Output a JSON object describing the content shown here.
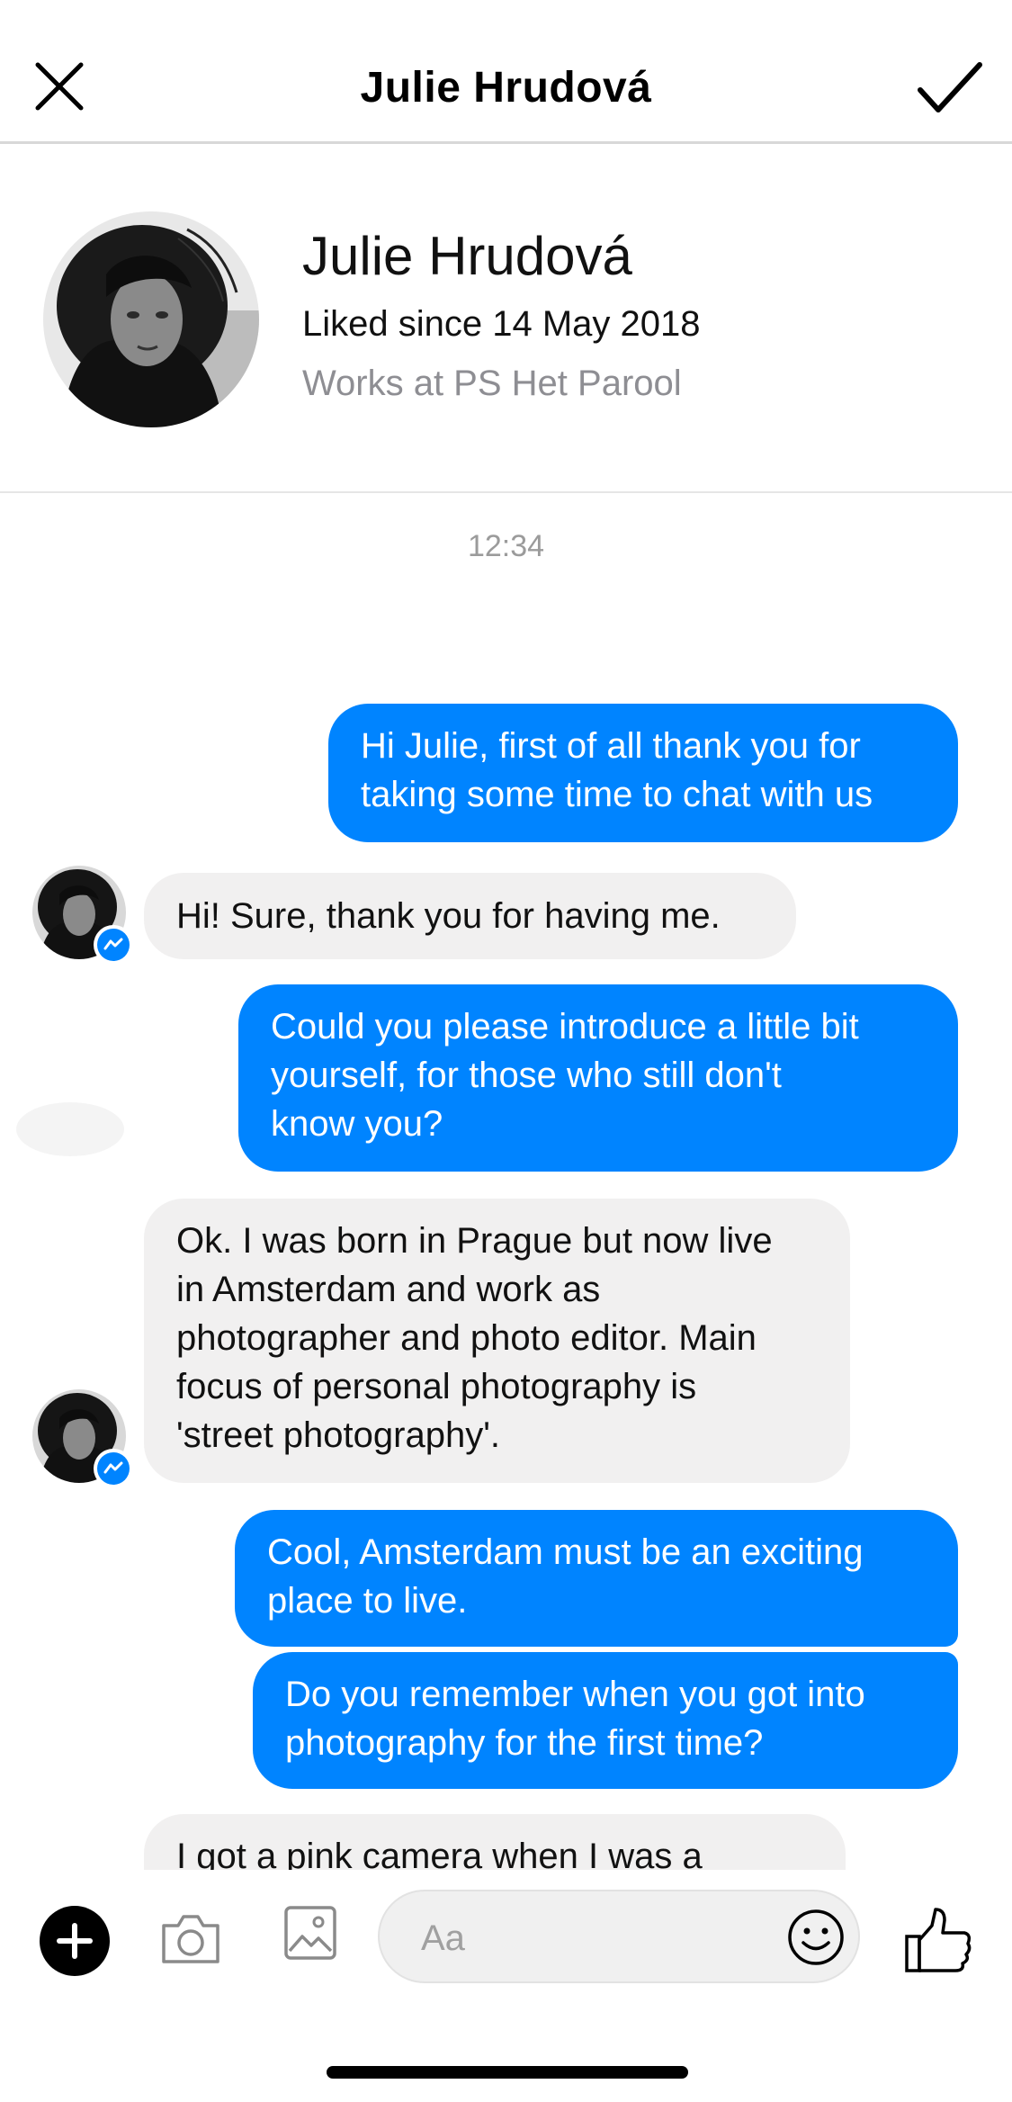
{
  "header": {
    "title": "Julie Hrudová"
  },
  "profile": {
    "name": "Julie Hrudová",
    "liked_since": "Liked since 14 May 2018",
    "works_at": "Works at PS Het Parool"
  },
  "conversation": {
    "timestamp": "12:34",
    "messages": [
      {
        "from": "me",
        "text": "Hi Julie, first of all thank you for\ntaking some time to chat with us"
      },
      {
        "from": "them",
        "text": "Hi! Sure, thank you for having me."
      },
      {
        "from": "me",
        "text": "Could you please introduce a little bit\nyourself, for those who still don't\nknow you?"
      },
      {
        "from": "them",
        "text": "Ok. I was born in Prague but now live\nin Amsterdam and work as\nphotographer and photo editor. Main\nfocus of personal photography is\n'street photography'."
      },
      {
        "from": "me",
        "text": "Cool, Amsterdam must be an exciting\nplace to live."
      },
      {
        "from": "me",
        "text": "Do you remember when you got into\nphotography for the first time?"
      },
      {
        "from": "them",
        "text": "I got a pink camera when I was a"
      }
    ]
  },
  "composer": {
    "placeholder": "Aa"
  },
  "icons": {
    "close": "close-icon",
    "confirm": "checkmark-icon",
    "add": "plus-icon",
    "camera": "camera-icon",
    "gallery": "image-icon",
    "emoji": "smiley-icon",
    "like": "thumbs-up-icon",
    "badge": "messenger-icon"
  },
  "colors": {
    "outgoing_bubble": "#0084ff",
    "incoming_bubble": "#f1f0f0",
    "secondary_text": "#8e8e93"
  }
}
